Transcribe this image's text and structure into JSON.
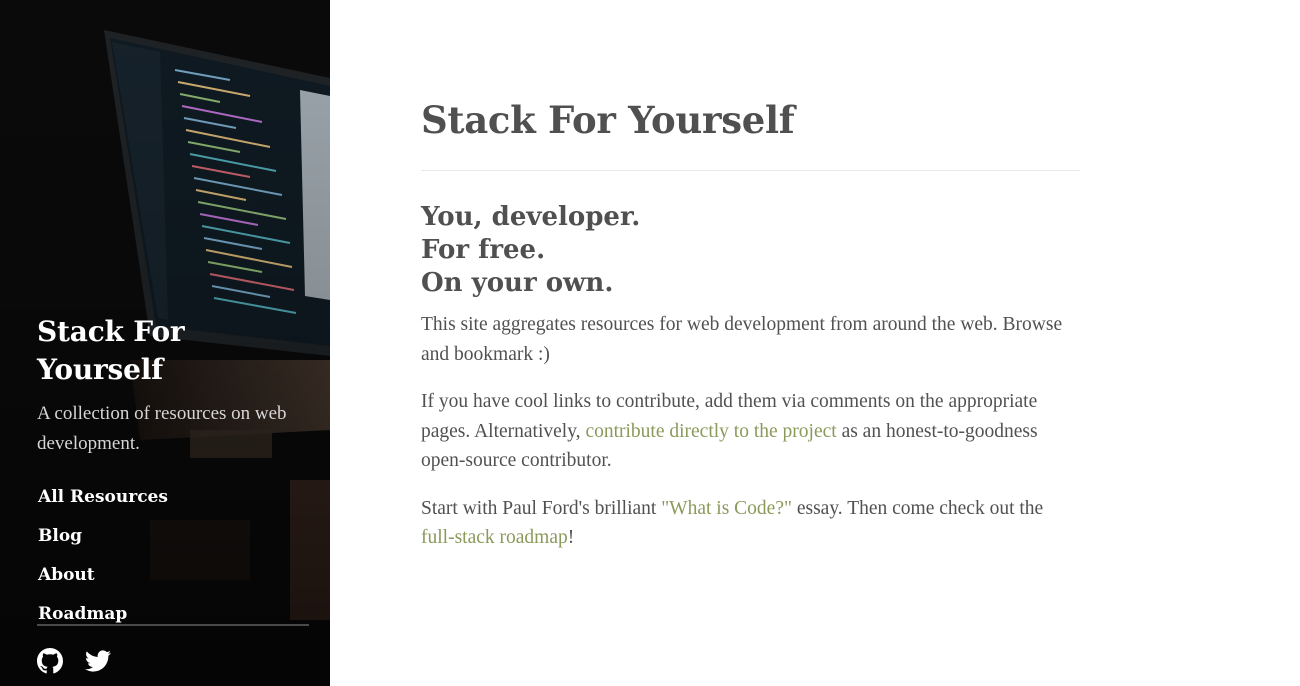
{
  "sidebar": {
    "title": "Stack For Yourself",
    "tagline": "A collection of resources on web development.",
    "nav": [
      {
        "label": "All Resources"
      },
      {
        "label": "Blog"
      },
      {
        "label": "About"
      },
      {
        "label": "Roadmap"
      }
    ],
    "social": [
      {
        "icon": "github-icon"
      },
      {
        "icon": "twitter-icon"
      }
    ]
  },
  "main": {
    "title": "Stack For Yourself",
    "headline": [
      "You, developer.",
      "For free.",
      "On your own."
    ],
    "para1": "This site aggregates resources for web development from around the web. Browse and bookmark :)",
    "para2": {
      "before": "If you have cool links to contribute, add them via comments on the appropriate pages. Alternatively, ",
      "link": "contribute directly to the project",
      "after": " as an honest-to-goodness open-source contributor."
    },
    "para3": {
      "before": "Start with Paul Ford's brilliant ",
      "link1": "\"What is Code?\"",
      "middle": " essay. Then come check out the ",
      "link2": "full-stack roadmap",
      "after": "!"
    }
  },
  "colors": {
    "sidebar_bg": "#0b0b0b",
    "text": "#515151",
    "heading": "#505050",
    "link": "#8a9a5b"
  }
}
